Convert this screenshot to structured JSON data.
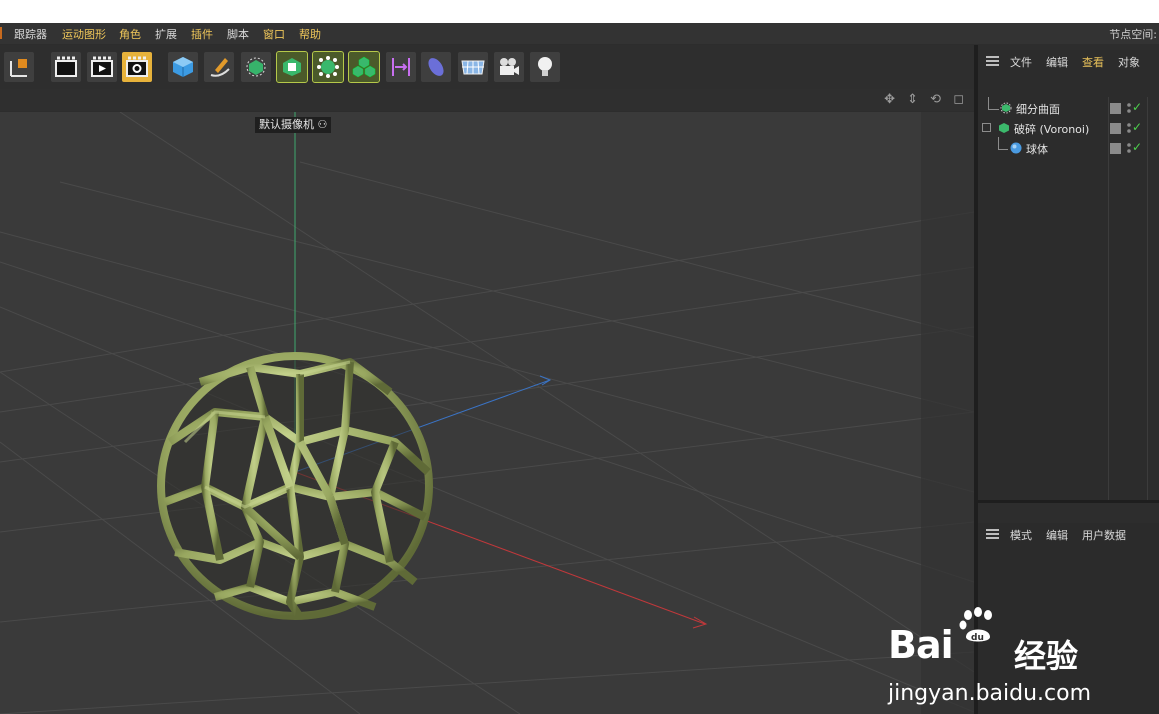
{
  "menubar": {
    "items": [
      "跟踪器",
      "运动图形",
      "角色",
      "扩展",
      "插件",
      "脚本",
      "窗口",
      "帮助"
    ],
    "right_text": "节点空间:"
  },
  "toolbar": {
    "buttons": [
      "axis-tool-icon",
      "render-view-icon",
      "render-to-picture-viewer-icon",
      "render-settings-icon",
      "cube-icon",
      "pen-icon",
      "subdivision-icon",
      "extrude-icon",
      "cloner-icon",
      "voronoi-icon",
      "deformer-icon",
      "field-icon",
      "floor-icon",
      "camera-icon",
      "light-icon"
    ]
  },
  "viewport": {
    "camera_label": "默认摄像机",
    "nav_icons": "✥ ⇕ ⟲ ◻"
  },
  "object_manager": {
    "menu": [
      "文件",
      "编辑",
      "查看",
      "对象"
    ],
    "objects": [
      {
        "name": "细分曲面",
        "icon": "subdivision-surface-icon"
      },
      {
        "name": "破碎 (Voronoi)",
        "icon": "voronoi-fracture-icon"
      },
      {
        "name": "球体",
        "icon": "sphere-icon"
      }
    ]
  },
  "attribute_manager": {
    "menu": [
      "模式",
      "编辑",
      "用户数据"
    ]
  },
  "watermark": {
    "brand": "Bai",
    "brand_cn": "经验",
    "url": "jingyan.baidu.com"
  },
  "colors": {
    "accent": "#e8c15a",
    "sphere": "#a9b771",
    "x_axis": "#c0383b",
    "y_axis": "#3fa86d",
    "z_axis": "#3a74c6"
  }
}
